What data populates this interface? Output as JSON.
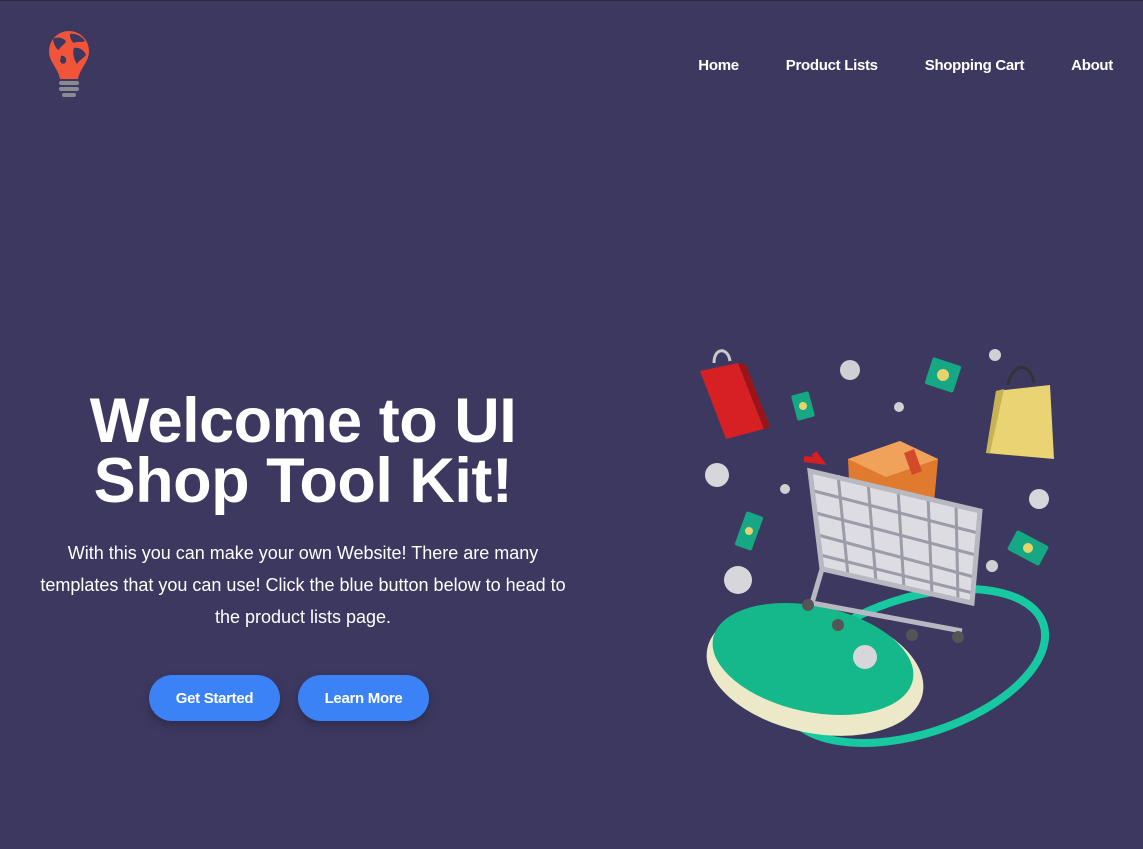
{
  "header": {
    "logo_icon": "lightbulb-globe-icon",
    "nav": [
      {
        "label": "Home"
      },
      {
        "label": "Product Lists"
      },
      {
        "label": "Shopping Cart"
      },
      {
        "label": "About"
      }
    ]
  },
  "hero": {
    "title_line1": "Welcome to UI",
    "title_line2": "Shop Tool Kit!",
    "description": "With this you can make your own Website! There are many templates that you can use! Click the blue button below to head to the product lists page.",
    "buttons": {
      "primary_label": "Get Started",
      "secondary_label": "Learn More"
    },
    "illustration": "shopping-cart-illustration"
  },
  "colors": {
    "background": "#3d3860",
    "button": "#3b82f6",
    "logo_accent": "#f0553a",
    "platform_green": "#14b88a"
  }
}
